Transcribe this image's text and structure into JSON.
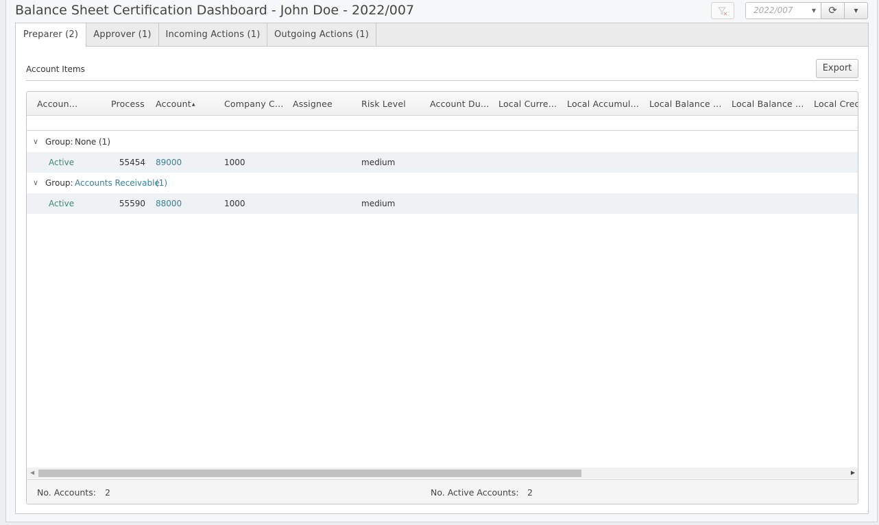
{
  "header": {
    "title": "Balance Sheet Certification Dashboard - John Doe - 2022/007",
    "period_value": "2022/007"
  },
  "tabs": [
    {
      "label": "Preparer (2)",
      "active": true
    },
    {
      "label": "Approver (1)"
    },
    {
      "label": "Incoming Actions (1)"
    },
    {
      "label": "Outgoing Actions (1)"
    }
  ],
  "section": {
    "label": "Account Items",
    "export_label": "Export"
  },
  "grid": {
    "columns": [
      "Accoun...",
      "Process",
      "Account",
      "Company C...",
      "Assignee",
      "Risk Level",
      "Account Du...",
      "Local Curre...",
      "Local Accumul...",
      "Local Balance ...",
      "Local Balance ...",
      "Local Cred"
    ],
    "sort_indicator": "▲",
    "groups": [
      {
        "prefix": "Group:",
        "name": "None",
        "count": "(1)",
        "row": {
          "status": "Active",
          "process": "55454",
          "account": "89000",
          "company_code": "1000",
          "assignee": "",
          "risk_level": "medium"
        }
      },
      {
        "prefix": "Group:",
        "name": "Accounts Receivable",
        "count": "(1)",
        "row": {
          "status": "Active",
          "process": "55590",
          "account": "88000",
          "company_code": "1000",
          "assignee": "",
          "risk_level": "medium"
        }
      }
    ]
  },
  "footer": {
    "accounts_label": "No. Accounts:",
    "accounts_value": "2",
    "active_label": "No. Active Accounts:",
    "active_value": "2"
  },
  "icons": {
    "filter": "filter-clear-icon",
    "refresh": "refresh-icon",
    "menu": "chevron-down-icon"
  },
  "colors": {
    "link": "#3a7f96",
    "status": "#3f8a70",
    "row_highlight": "#eff2f4"
  }
}
